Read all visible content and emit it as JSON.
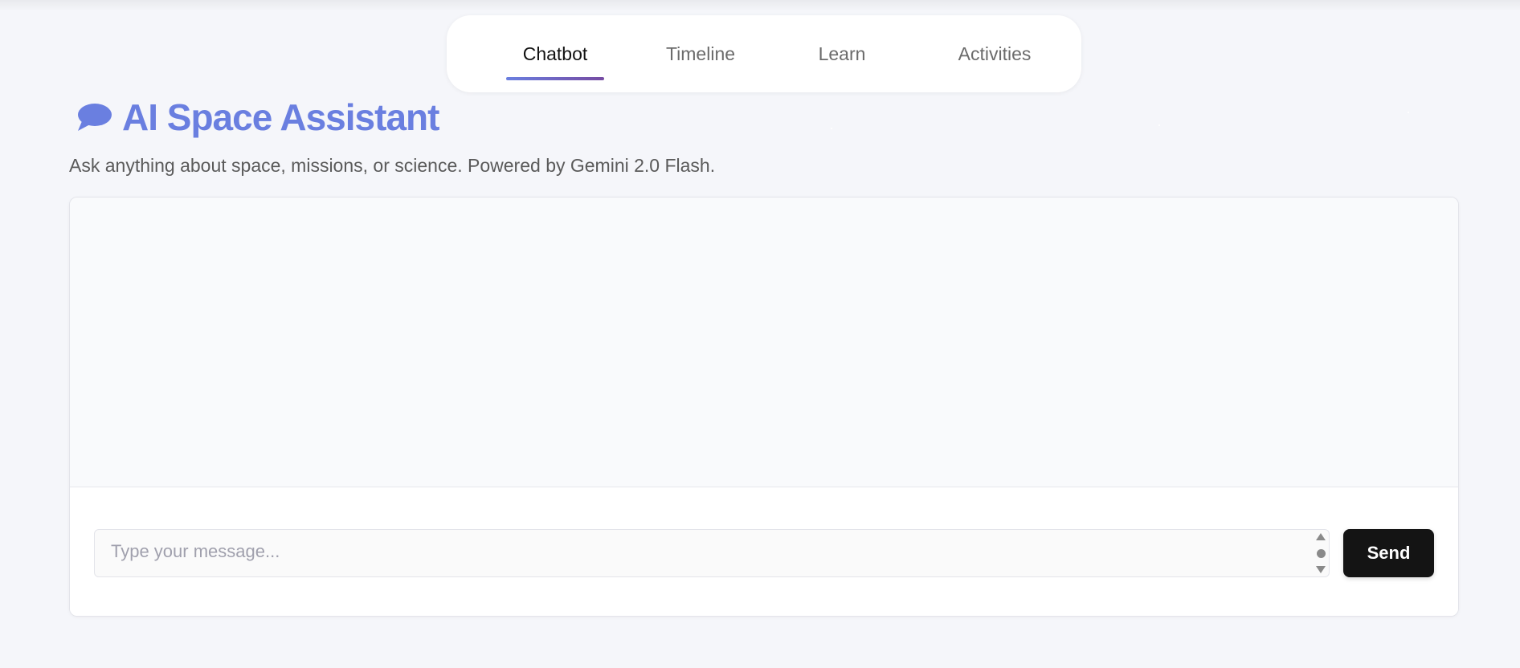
{
  "nav": {
    "tabs": [
      {
        "label": "Chatbot",
        "active": true
      },
      {
        "label": "Timeline",
        "active": false
      },
      {
        "label": "Learn",
        "active": false
      },
      {
        "label": "Activities",
        "active": false
      }
    ]
  },
  "header": {
    "icon": "speech-bubble-icon",
    "title": "AI Space Assistant",
    "subtitle": "Ask anything about space, missions, or science. Powered by Gemini 2.0 Flash."
  },
  "chat": {
    "input_placeholder": "Type your message...",
    "input_value": "",
    "send_label": "Send"
  },
  "colors": {
    "accent": "#6a7fe0",
    "accent_end": "#764ba2",
    "send_bg": "#141414",
    "page_bg": "#f5f6fa"
  }
}
